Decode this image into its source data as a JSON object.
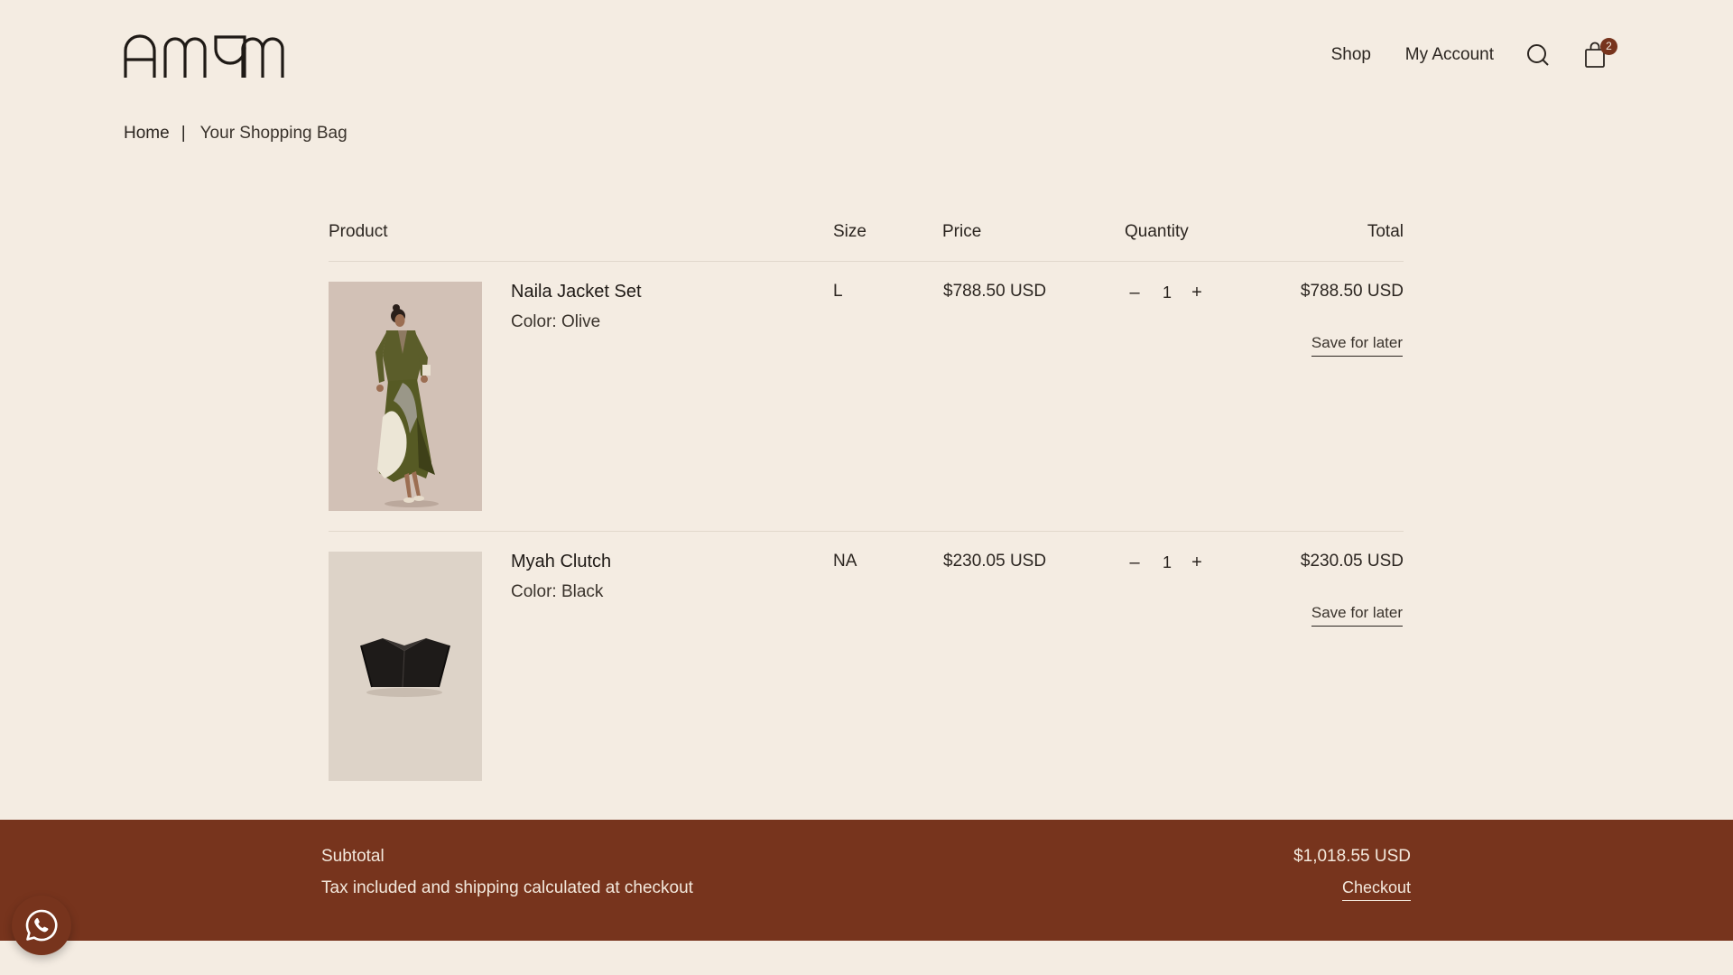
{
  "brand": {
    "logo_text": "AMAM"
  },
  "nav": {
    "shop": "Shop",
    "account": "My Account",
    "cart_count": "2"
  },
  "breadcrumb": {
    "home": "Home",
    "separator": "|",
    "current": "Your Shopping Bag"
  },
  "table": {
    "headers": {
      "product": "Product",
      "size": "Size",
      "price": "Price",
      "quantity": "Quantity",
      "total": "Total"
    },
    "items": [
      {
        "name": "Naila Jacket Set",
        "color": "Color: Olive",
        "size": "L",
        "price": "$788.50 USD",
        "quantity": "1",
        "total": "$788.50 USD",
        "save_label": "Save for later"
      },
      {
        "name": "Myah Clutch",
        "color": "Color: Black",
        "size": "NA",
        "price": "$230.05 USD",
        "quantity": "1",
        "total": "$230.05 USD",
        "save_label": "Save for later"
      }
    ]
  },
  "summary": {
    "subtotal_label": "Subtotal",
    "note": "Tax included and shipping calculated at checkout",
    "subtotal_value": "$1,018.55 USD",
    "checkout_label": "Checkout"
  },
  "colors": {
    "background": "#f4ece2",
    "accent": "#77341d",
    "text": "#2b2520"
  },
  "icons": {
    "search": "search-icon",
    "bag": "shopping-bag-icon",
    "whatsapp": "whatsapp-icon"
  }
}
